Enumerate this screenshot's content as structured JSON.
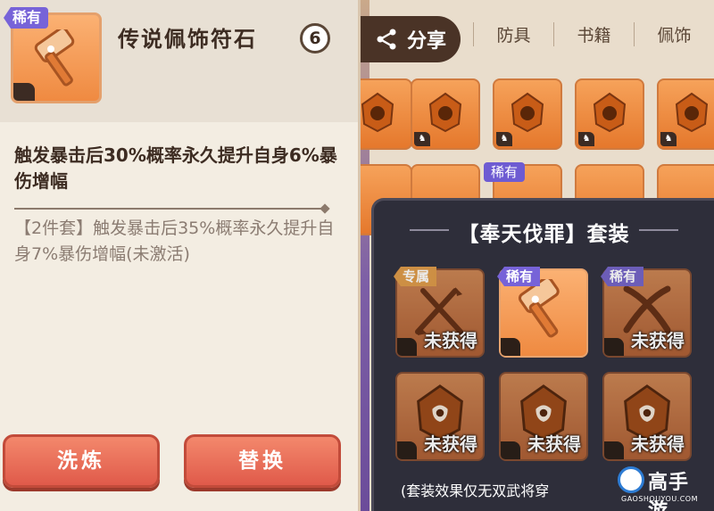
{
  "share": {
    "label": "分享",
    "icon": "share-icon"
  },
  "tabs": [
    {
      "label": "防具"
    },
    {
      "label": "书籍"
    },
    {
      "label": "佩饰"
    }
  ],
  "inventory": {
    "rare_badge": "稀有"
  },
  "item": {
    "rarity": "稀有",
    "name": "传说佩饰符石",
    "level": "6",
    "effect": "触发暴击后30%概率永久提升自身6%暴伤增幅",
    "set_effect": "【2件套】触发暴击后35%概率永久提升自身7%暴伤增幅(未激活)"
  },
  "buttons": {
    "refine": "洗炼",
    "replace": "替换"
  },
  "set_panel": {
    "title": "【奉天伐罪】套装",
    "slots": [
      {
        "tag": "专属",
        "tag_type": "exclusive",
        "status": "未获得",
        "kind": "crossed-weapons"
      },
      {
        "tag": "稀有",
        "tag_type": "rare",
        "status": "",
        "kind": "hammer"
      },
      {
        "tag": "稀有",
        "tag_type": "rare",
        "status": "未获得",
        "kind": "crossed-blades"
      },
      {
        "tag": "",
        "tag_type": "",
        "status": "未获得",
        "kind": "gem"
      },
      {
        "tag": "",
        "tag_type": "",
        "status": "未获得",
        "kind": "gem"
      },
      {
        "tag": "",
        "tag_type": "",
        "status": "未获得",
        "kind": "gem"
      }
    ],
    "note": "(套装效果仅无双武将穿"
  },
  "watermark": {
    "name": "高手游",
    "url": "GAOSHOUYOU.COM"
  },
  "colors": {
    "panel_bg": "#f3ede2",
    "set_panel_bg": "#2e2e3a",
    "button_red": "#e05a4a",
    "rare_purple": "#7763d8",
    "exclusive_gold": "#e99a3a",
    "slot_orange": "#ef8a41"
  }
}
